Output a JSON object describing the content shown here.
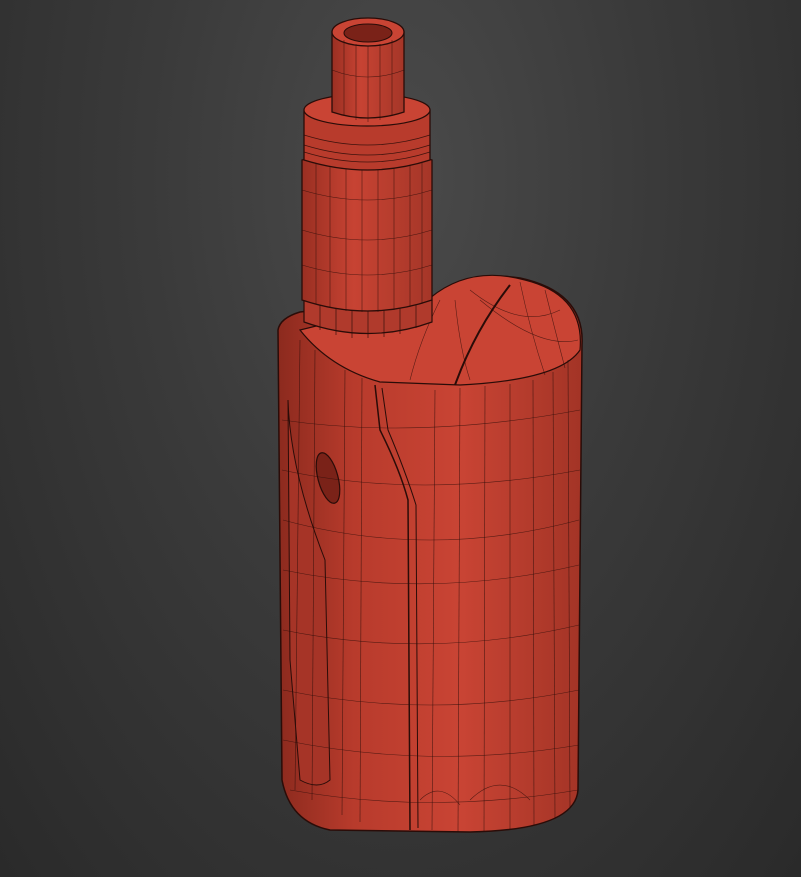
{
  "scene": {
    "subject": "vape-box-mod-wireframe-model",
    "background_color": "#3a3a3a",
    "model_fill_color": "#c24030",
    "model_shadow_color": "#8c2a1e",
    "wire_color": "#2a0c08"
  }
}
